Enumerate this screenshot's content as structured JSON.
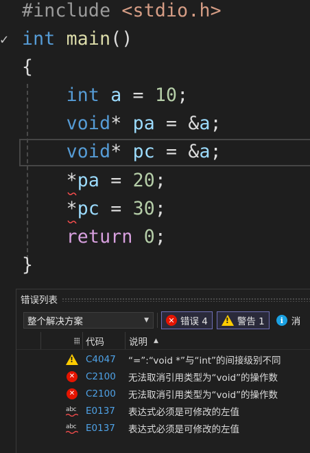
{
  "editor": {
    "fold_glyph": "✓",
    "lines": [
      [
        {
          "t": "#include ",
          "c": "pre"
        },
        {
          "t": "<stdio.h>",
          "c": "str"
        }
      ],
      [
        {
          "t": "int",
          "c": "kw"
        },
        {
          "t": " ",
          "c": "op"
        },
        {
          "t": "main",
          "c": "fn"
        },
        {
          "t": "()",
          "c": "op"
        }
      ],
      [
        {
          "t": "{",
          "c": "op"
        }
      ],
      [
        {
          "t": "    ",
          "c": "op"
        },
        {
          "t": "int",
          "c": "kw"
        },
        {
          "t": " ",
          "c": "op"
        },
        {
          "t": "a",
          "c": "var"
        },
        {
          "t": " = ",
          "c": "op"
        },
        {
          "t": "10",
          "c": "num"
        },
        {
          "t": ";",
          "c": "op"
        }
      ],
      [
        {
          "t": "    ",
          "c": "op"
        },
        {
          "t": "void",
          "c": "kw"
        },
        {
          "t": "* ",
          "c": "op"
        },
        {
          "t": "pa",
          "c": "var"
        },
        {
          "t": " = &",
          "c": "op"
        },
        {
          "t": "a",
          "c": "var"
        },
        {
          "t": ";",
          "c": "op"
        }
      ],
      [
        {
          "t": "    ",
          "c": "op"
        },
        {
          "t": "void",
          "c": "kw"
        },
        {
          "t": "* ",
          "c": "op"
        },
        {
          "t": "pc",
          "c": "var"
        },
        {
          "t": " = &",
          "c": "op"
        },
        {
          "t": "a",
          "c": "var"
        },
        {
          "t": ";",
          "c": "op"
        }
      ],
      [
        {
          "t": "    ",
          "c": "op"
        },
        {
          "t": "*",
          "c": "op"
        },
        {
          "t": "pa",
          "c": "var"
        },
        {
          "t": " = ",
          "c": "op"
        },
        {
          "t": "20",
          "c": "num"
        },
        {
          "t": ";",
          "c": "op"
        }
      ],
      [
        {
          "t": "    ",
          "c": "op"
        },
        {
          "t": "*",
          "c": "op"
        },
        {
          "t": "pc",
          "c": "var"
        },
        {
          "t": " = ",
          "c": "op"
        },
        {
          "t": "30",
          "c": "num"
        },
        {
          "t": ";",
          "c": "op"
        }
      ],
      [
        {
          "t": "    ",
          "c": "op"
        },
        {
          "t": "return",
          "c": "ctl"
        },
        {
          "t": " ",
          "c": "op"
        },
        {
          "t": "0",
          "c": "num"
        },
        {
          "t": ";",
          "c": "op"
        }
      ],
      [
        {
          "t": "}",
          "c": "op"
        }
      ]
    ]
  },
  "error_list": {
    "title": "错误列表",
    "scope": "整个解决方案",
    "errors_button": "错误 4",
    "warnings_button": "警告 1",
    "messages_button": "消",
    "columns": {
      "code": "代码",
      "description": "说明"
    },
    "rows": [
      {
        "type": "warning",
        "icon": "warning-icon",
        "code": "C4047",
        "description": "“=”:“void *”与“int”的间接级别不同"
      },
      {
        "type": "error",
        "icon": "error-icon",
        "code": "C2100",
        "description": "无法取消引用类型为“void”的操作数"
      },
      {
        "type": "error",
        "icon": "error-icon",
        "code": "C2100",
        "description": "无法取消引用类型为“void”的操作数"
      },
      {
        "type": "intellisense",
        "icon": "intellisense-error-icon",
        "code": "E0137",
        "description": "表达式必须是可修改的左值"
      },
      {
        "type": "intellisense",
        "icon": "intellisense-error-icon",
        "code": "E0137",
        "description": "表达式必须是可修改的左值"
      }
    ]
  },
  "colors": {
    "error": "#e51400",
    "warning": "#ffcc00",
    "info": "#1ba1e2",
    "code_link": "#4fa3e8"
  }
}
